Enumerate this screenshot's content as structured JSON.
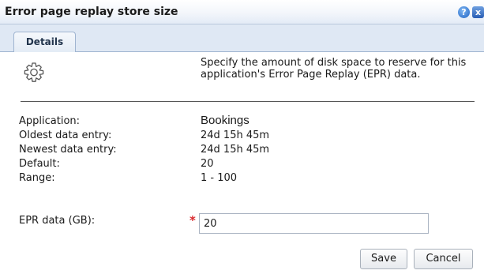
{
  "dialog": {
    "title": "Error page replay store size",
    "help_glyph": "?",
    "close_glyph": "x"
  },
  "tabs": [
    {
      "label": "Details",
      "selected": true
    }
  ],
  "intro": {
    "icon": "gear-icon",
    "text": "Specify the amount of disk space to reserve for this application's Error Page Replay (EPR) data."
  },
  "fields": {
    "application": {
      "label": "Application:",
      "value": "Bookings"
    },
    "oldest": {
      "label": "Oldest data entry:",
      "value": "24d 15h 45m"
    },
    "newest": {
      "label": "Newest data entry:",
      "value": "24d 15h 45m"
    },
    "default": {
      "label": "Default:",
      "value": "20"
    },
    "range": {
      "label": "Range:",
      "value": "1 - 100"
    }
  },
  "epr": {
    "label": "EPR data (GB):",
    "required_mark": "*",
    "value": "20"
  },
  "buttons": {
    "save": "Save",
    "cancel": "Cancel"
  },
  "colors": {
    "required": "#d8262a",
    "tab_strip": "#dfe8f4",
    "title_accent": "#1f63c4"
  }
}
